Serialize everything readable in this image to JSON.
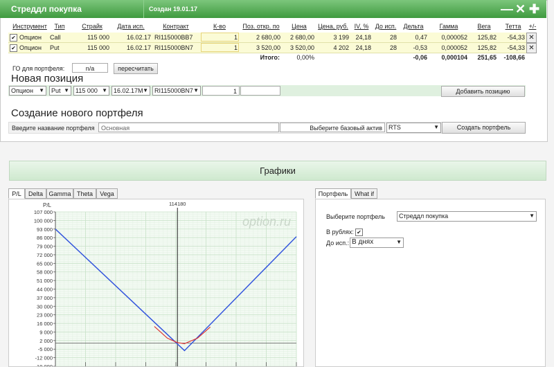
{
  "window": {
    "title": "Стреддл покупка",
    "created": "Создан 19.01.17",
    "controls": [
      "—",
      "✕",
      "✚"
    ]
  },
  "table": {
    "headers": [
      "Инструмент",
      "Тип",
      "Страйк",
      "Дата исп.",
      "Контракт",
      "К-во",
      "Поз. откр. по",
      "Цена",
      "Цена, руб.",
      "IV, %",
      "До исп.",
      "Дельта",
      "Гамма",
      "Вега",
      "Тетта",
      "+/-"
    ],
    "rows": [
      {
        "checked": true,
        "instrument": "Опцион",
        "type": "Call",
        "strike": "115 000",
        "date": "16.02.17",
        "contract": "RI115000BB7",
        "qty": "1",
        "open": "2 680,00",
        "price": "2 680,00",
        "price_rub": "3 199",
        "iv": "24,18",
        "days": "28",
        "delta": "0,47",
        "gamma": "0,000052",
        "vega": "125,82",
        "theta": "-54,33"
      },
      {
        "checked": true,
        "instrument": "Опцион",
        "type": "Put",
        "strike": "115 000",
        "date": "16.02.17",
        "contract": "RI115000BN7",
        "qty": "1",
        "open": "3 520,00",
        "price": "3 520,00",
        "price_rub": "4 202",
        "iv": "24,18",
        "days": "28",
        "delta": "-0,53",
        "gamma": "0,000052",
        "vega": "125,82",
        "theta": "-54,33"
      }
    ],
    "totals": {
      "label": "Итого:",
      "pct": "0,00%",
      "delta": "-0,06",
      "gamma": "0,000104",
      "vega": "251,65",
      "theta": "-108,66"
    }
  },
  "go": {
    "label": "ГО для портфеля:",
    "value": "n/a",
    "button": "пересчитать"
  },
  "new_position": {
    "title": "Новая позиция",
    "instrument": "Опцион",
    "type": "Put",
    "strike": "115 000",
    "date": "16.02.17M",
    "contract": "RI115000BN7",
    "qty": "1",
    "button": "Добавить позицию"
  },
  "new_portfolio": {
    "title": "Создание нового портфеля",
    "name_label": "Введите название портфеля",
    "name_value": "Основная",
    "asset_label": "Выберите базовый актив",
    "asset_value": "RTS",
    "button": "Создать портфель"
  },
  "charts": {
    "title": "Графики",
    "tabs": [
      "P/L",
      "Delta",
      "Gamma",
      "Theta",
      "Vega"
    ],
    "active_tab": "P/L",
    "watermark": "option.ru",
    "ylabel": "P/L",
    "marker": "114180",
    "chart_data": {
      "type": "line",
      "ylabel": "P/L",
      "yticks": [
        "107 000",
        "100 000",
        "93 000",
        "86 000",
        "79 000",
        "72 000",
        "65 000",
        "58 000",
        "51 000",
        "44 000",
        "37 000",
        "30 000",
        "23 000",
        "16 000",
        "9 000",
        "2 000",
        "-5 000",
        "-12 000",
        "-19 000"
      ],
      "ylim": [
        -19000,
        107000
      ],
      "xlim": [
        100000,
        128000
      ],
      "marker_x": 114180,
      "series": [
        {
          "color": "#3355dd",
          "x": [
            100000,
            115000,
            128000
          ],
          "y": [
            93000,
            -6200,
            86800
          ]
        },
        {
          "color": "#dd3333",
          "x": [
            111500,
            113000,
            114180,
            115000,
            116500,
            118000
          ],
          "y": [
            13500,
            4000,
            300,
            -500,
            3900,
            13100
          ]
        }
      ]
    }
  },
  "right_panel": {
    "tabs": [
      "Портфель",
      "What if"
    ],
    "active_tab": "Портфель",
    "portfolio_label": "Выберите портфель",
    "portfolio_value": "Стреддл покупка",
    "rub_label": "В рублях:",
    "days_label": "До исп.:",
    "days_value": "В днях"
  },
  "colors": {
    "accent": "#3f9a3f",
    "row_bg": "#fbfbd6",
    "grid": "#d7ecd7"
  }
}
